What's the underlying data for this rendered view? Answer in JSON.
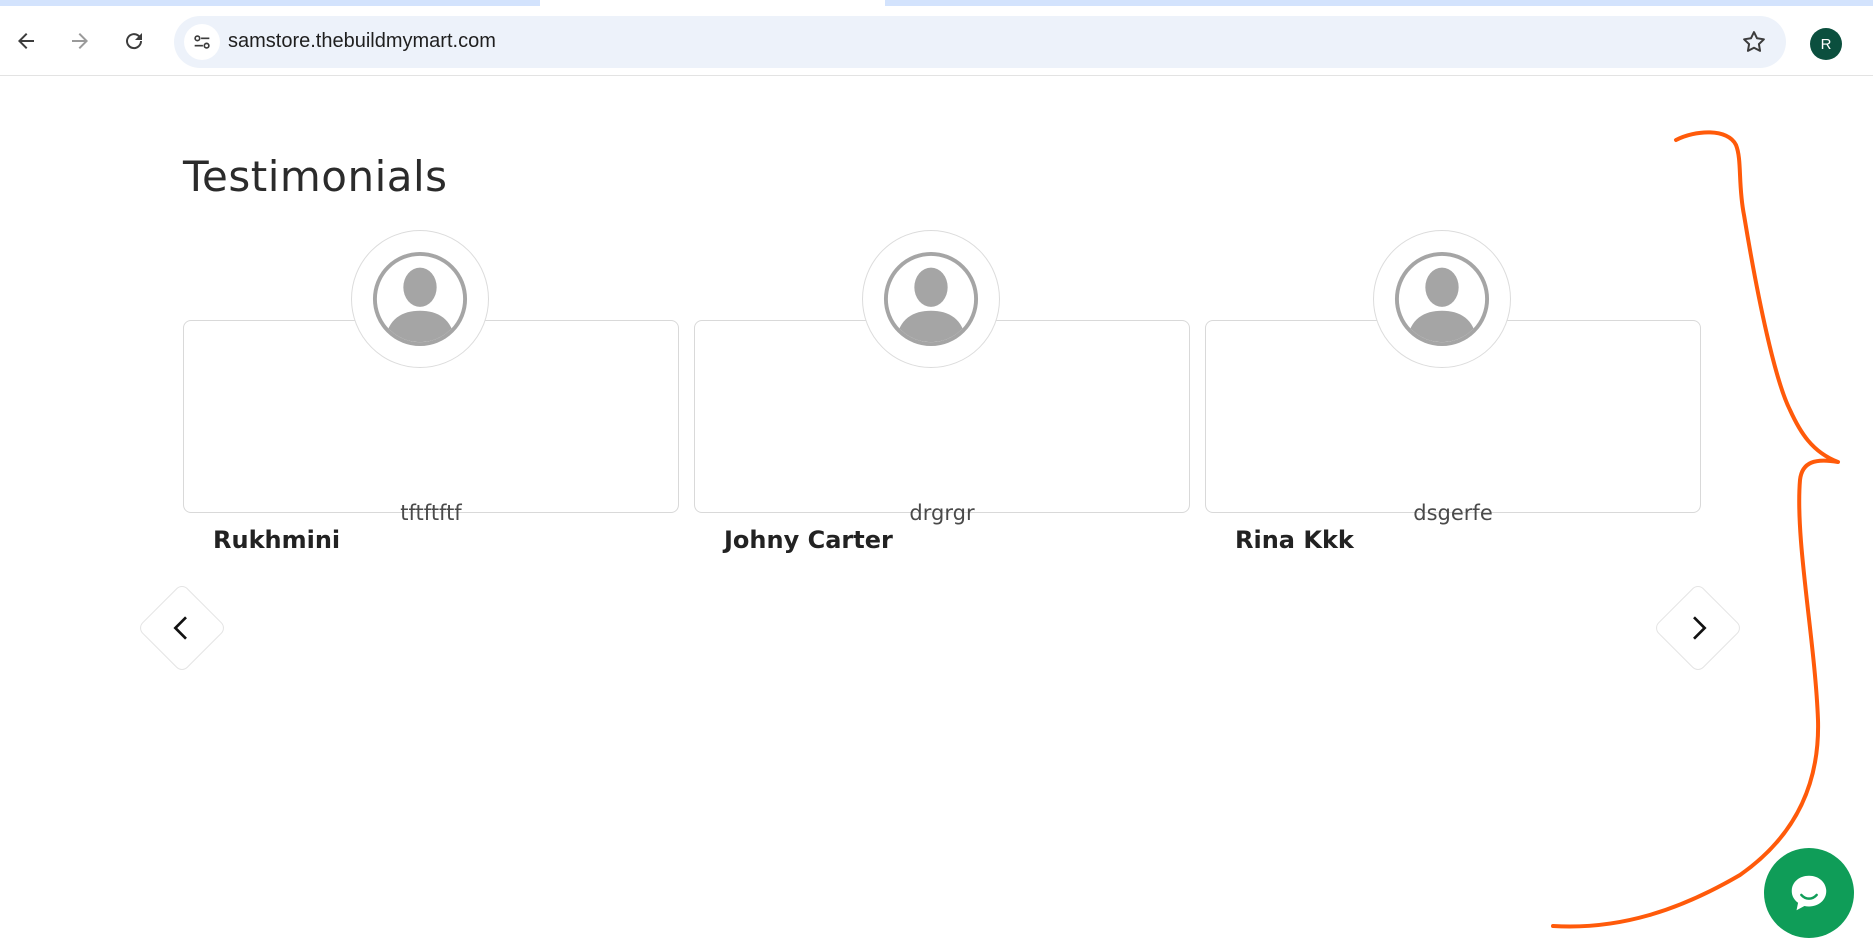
{
  "browser": {
    "url": "samstore.thebuildmymart.com",
    "profile_initial": "R",
    "icons": {
      "back": "back-arrow-icon",
      "forward": "forward-arrow-icon",
      "reload": "reload-icon",
      "site_info": "tune-icon",
      "bookmark": "star-icon"
    }
  },
  "page": {
    "title": "Testimonials",
    "testimonials": [
      {
        "quote": "tftftftf",
        "name": "Rukhmini"
      },
      {
        "quote": "drgrgr",
        "name": "Johny Carter"
      },
      {
        "quote": "dsgerfe",
        "name": "Rina Kkk"
      }
    ]
  },
  "colors": {
    "accent_chat": "#0f9d58",
    "annotation_stroke": "#ff5a0a",
    "profile_bg": "#0b4f3e"
  }
}
